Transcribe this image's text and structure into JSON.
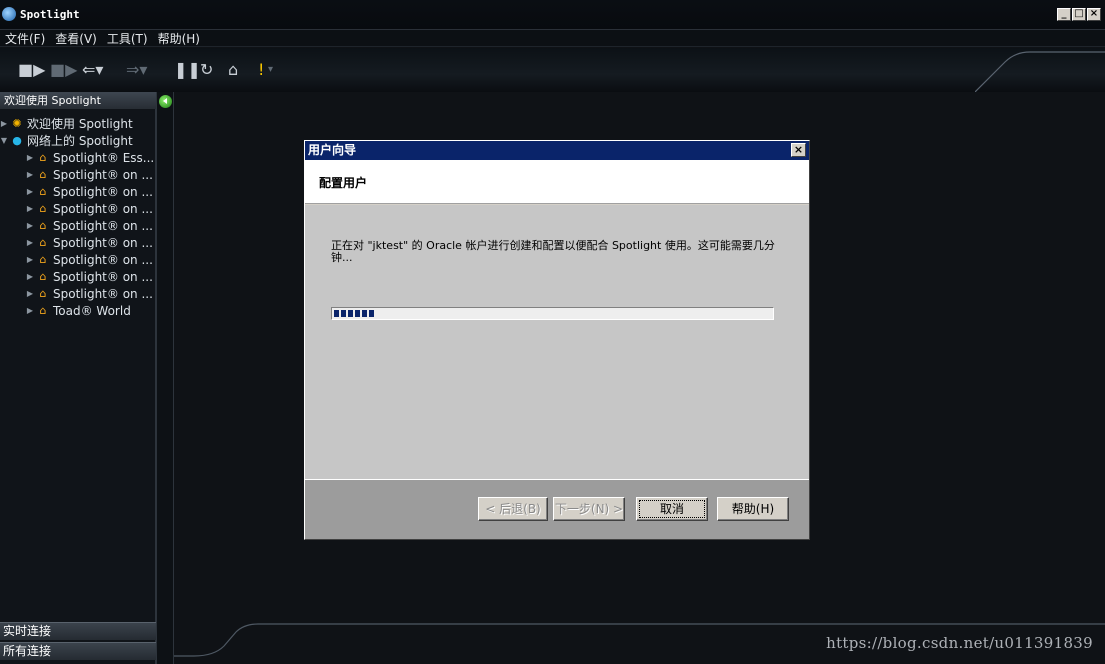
{
  "app": {
    "title": "Spotlight",
    "window_controls": [
      "_",
      "□",
      "×"
    ]
  },
  "menu": [
    "文件(F)",
    "查看(V)",
    "工具(T)",
    "帮助(H)"
  ],
  "toolbar": {
    "icons": [
      "connect-icon",
      "disconnect-icon",
      "back-icon",
      "forward-icon",
      "pause-icon",
      "refresh-icon",
      "home-icon",
      "alert-icon"
    ]
  },
  "left_panel": {
    "header": "欢迎使用 Spotlight",
    "tree": [
      {
        "label": "欢迎使用 Spotlight",
        "icon": "sun-icon",
        "level": 0,
        "expanded": false
      },
      {
        "label": "网络上的 Spotlight",
        "icon": "globe-icon",
        "level": 0,
        "expanded": true
      },
      {
        "label": "Spotlight® Ess...",
        "icon": "house-icon",
        "level": 1
      },
      {
        "label": "Spotlight® on ...",
        "icon": "house-icon",
        "level": 1
      },
      {
        "label": "Spotlight® on ...",
        "icon": "house-icon",
        "level": 1
      },
      {
        "label": "Spotlight® on ...",
        "icon": "house-icon",
        "level": 1
      },
      {
        "label": "Spotlight® on ...",
        "icon": "house-icon",
        "level": 1
      },
      {
        "label": "Spotlight® on ...",
        "icon": "house-icon",
        "level": 1
      },
      {
        "label": "Spotlight® on ...",
        "icon": "house-icon",
        "level": 1
      },
      {
        "label": "Spotlight® on ...",
        "icon": "house-icon",
        "level": 1
      },
      {
        "label": "Spotlight® on ...",
        "icon": "house-icon",
        "level": 1
      },
      {
        "label": "Toad® World",
        "icon": "house-icon",
        "level": 1
      }
    ],
    "bottom_tabs": [
      "实时连接",
      "所有连接"
    ]
  },
  "dialog": {
    "title": "用户向导",
    "heading": "配置用户",
    "message": "正在对 \"jktest\" 的 Oracle 帐户进行创建和配置以便配合 Spotlight 使用。这可能需要几分钟...",
    "progress_percent": 9,
    "buttons": {
      "back": "< 后退(B)",
      "next": "下一步(N) >",
      "cancel": "取消",
      "help": "帮助(H)"
    }
  },
  "watermark": "https://blog.csdn.net/u011391839"
}
